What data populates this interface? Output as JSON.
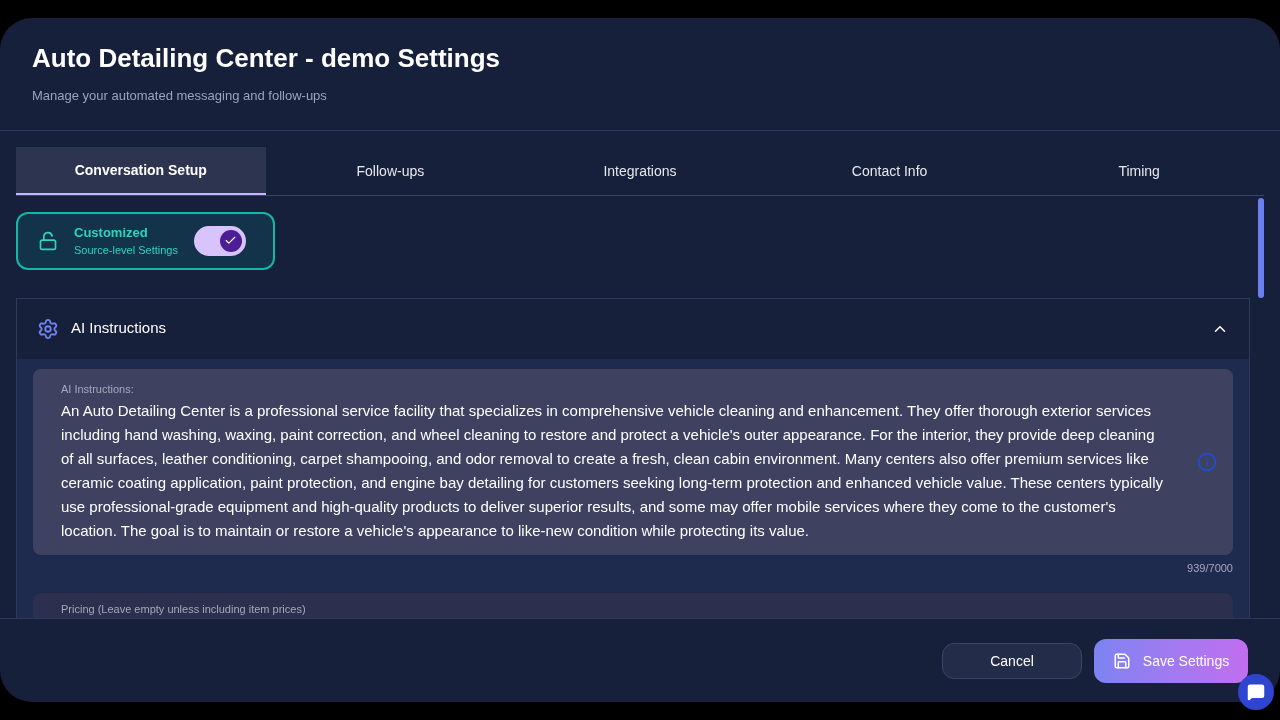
{
  "dialog": {
    "title": "Auto Detailing Center - demo Settings",
    "subtitle": "Manage your automated messaging and follow-ups"
  },
  "tabs": [
    {
      "label": "Conversation Setup",
      "selected": true
    },
    {
      "label": "Follow-ups",
      "selected": false
    },
    {
      "label": "Integrations",
      "selected": false
    },
    {
      "label": "Contact Info",
      "selected": false
    },
    {
      "label": "Timing",
      "selected": false
    }
  ],
  "mode_card": {
    "title": "Customized",
    "subtitle": "Source-level Settings",
    "checked": true
  },
  "section": {
    "title": "AI Instructions",
    "expanded": true,
    "fields": [
      {
        "label": "AI Instructions:",
        "value": "An Auto Detailing Center is a professional service facility that specializes in comprehensive vehicle cleaning and enhancement. They offer thorough exterior services including hand washing, waxing, paint correction, and wheel cleaning to restore and protect a vehicle's outer appearance. For the interior, they provide deep cleaning of all surfaces, leather conditioning, carpet shampooing, and odor removal to create a fresh, clean cabin environment. Many centers also offer premium services like ceramic coating application, paint protection, and engine bay detailing for customers seeking long-term protection and enhanced vehicle value. These centers typically use professional-grade equipment and high-quality products to deliver superior results, and some may offer mobile services where they come to the customer's location. The goal is to maintain or restore a vehicle's appearance to like-new condition while protecting its value.",
        "counter": "939/7000"
      },
      {
        "label": "Pricing (Leave empty unless including item prices)"
      }
    ]
  },
  "buttons": [
    {
      "kind": "secondary",
      "label": "Cancel"
    },
    {
      "kind": "primary",
      "label": "Save Settings"
    }
  ]
}
